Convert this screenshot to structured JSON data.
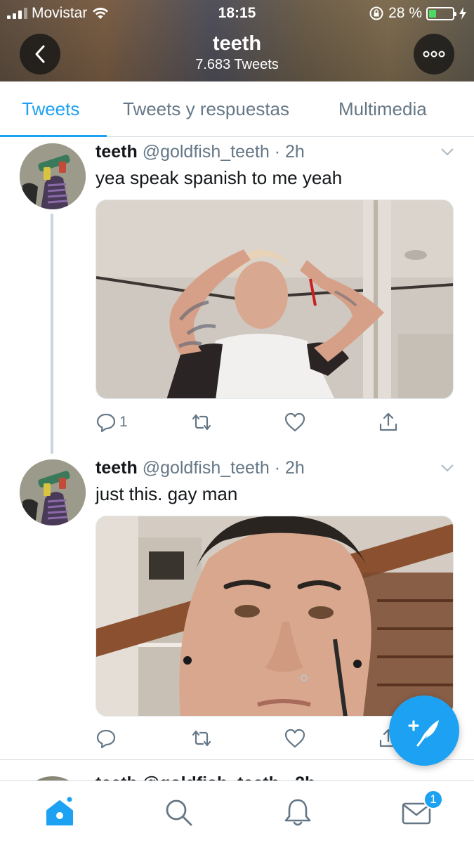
{
  "status_bar": {
    "carrier": "Movistar",
    "time": "18:15",
    "battery": "28 %",
    "battery_level": 0.28
  },
  "header": {
    "name": "teeth",
    "tweet_count": "7.683 Tweets"
  },
  "tabs": [
    {
      "label": "Tweets",
      "active": true
    },
    {
      "label": "Tweets y respuestas",
      "active": false
    },
    {
      "label": "Multimedia",
      "active": false
    }
  ],
  "tweets": [
    {
      "name": "teeth",
      "handle": "@goldfish_teeth",
      "time": "· 2h",
      "text": "yea speak spanish to me yeah",
      "reply_count": "1"
    },
    {
      "name": "teeth",
      "handle": "@goldfish_teeth",
      "time": "· 2h",
      "text": "just this. gay man",
      "reply_count": ""
    }
  ],
  "partial_tweet": {
    "text": "teeth @goldfish_teeth · 2h"
  },
  "bottom_nav": {
    "messages_badge": "1"
  },
  "colors": {
    "accent": "#1da1f2",
    "secondary_text": "#657786",
    "primary_text": "#14171a"
  }
}
